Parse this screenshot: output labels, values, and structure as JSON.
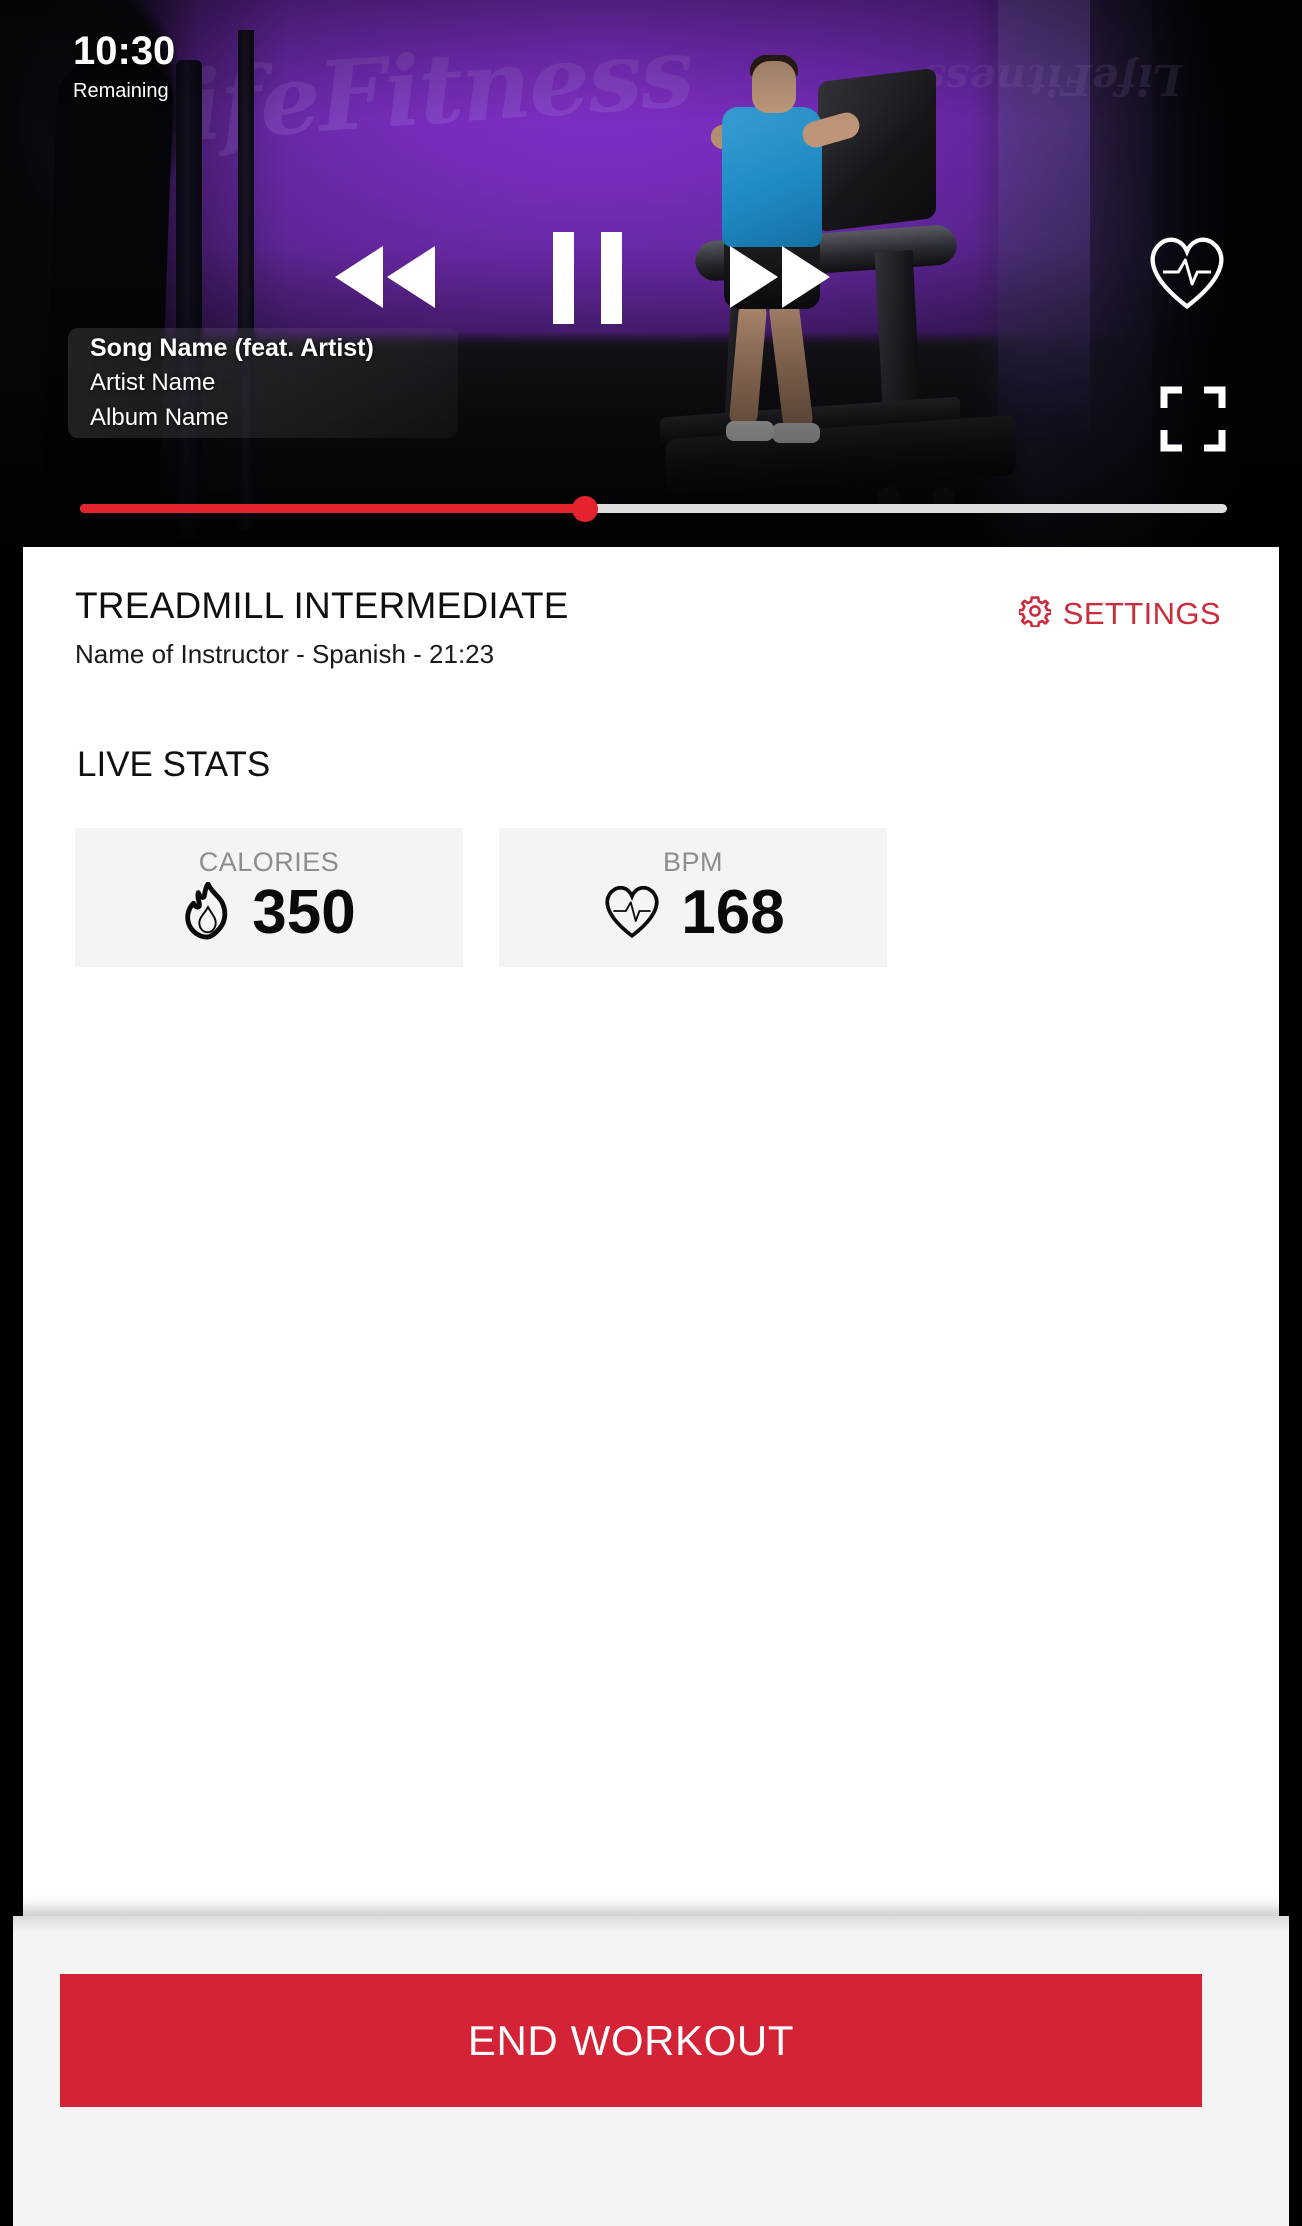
{
  "player": {
    "timer_value": "10:30",
    "timer_label": "Remaining",
    "controls": {
      "rewind": "rewind-button",
      "pause": "pause-button",
      "forward": "fast-forward-button"
    },
    "favorite_icon": "heart-pulse-icon",
    "fullscreen_icon": "fullscreen-icon",
    "now_playing": {
      "song": "Song Name (feat. Artist)",
      "artist": "Artist Name",
      "album": "Album Name"
    },
    "progress": {
      "percent": 44,
      "fill_color": "#e5232f",
      "track_color": "#dedede"
    }
  },
  "header": {
    "title": "TREADMILL INTERMEDIATE",
    "subtitle": "Name of Instructor - Spanish - 21:23",
    "settings_label": "SETTINGS",
    "settings_icon": "gear-icon",
    "settings_color": "#cc2b3c"
  },
  "live_stats": {
    "section_title": "LIVE STATS",
    "cards": [
      {
        "label": "CALORIES",
        "value": "350",
        "icon": "flame-icon"
      },
      {
        "label": "BPM",
        "value": "168",
        "icon": "heart-pulse-icon"
      }
    ]
  },
  "footer": {
    "end_workout_label": "END WORKOUT",
    "end_workout_color": "#d42236"
  }
}
